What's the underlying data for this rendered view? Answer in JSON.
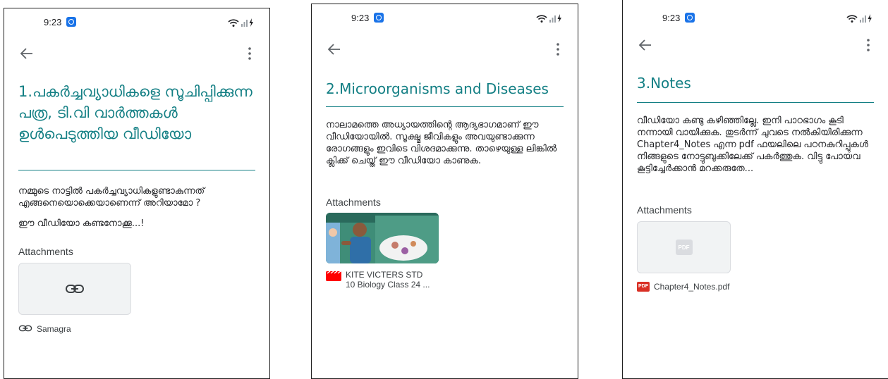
{
  "status_bar": {
    "time": "9:23"
  },
  "screens": [
    {
      "title": "1.പകർച്ചവ്യാധികളെ സൂചിപ്പിക്കുന്ന പത്ര, ടി.വി വാർത്തകൾ ഉൾപെടുത്തിയ വീഡിയോ",
      "paragraphs": [
        "നമ്മുടെ നാട്ടിൽ പകർച്ചവ്യാധികളുണ്ടാകുന്നത് എങ്ങനെയൊക്കെയാണെന്ന് അറിയാമോ ?",
        "ഈ വീഡിയോ കണ്ടനോക്കൂ...!"
      ],
      "attachments_heading": "Attachments",
      "attachment": {
        "kind": "link",
        "icon": "link-icon",
        "label": "Samagra"
      }
    },
    {
      "title": "2.Microorganisms and Diseases",
      "paragraphs": [
        "നാലാമത്തെ അധ്യായത്തിന്റെ ആദ്യഭാഗമാണ് ഈ വീഡിയോയിൽ. സൂക്ഷ്മ ജീവികളും അവയുണ്ടാക്കുന്ന രോഗങ്ങളും ഇവിടെ വിശദമാക്കുന്നു. താഴെയുള്ള ലിങ്കിൽ ക്ലിക്ക് ചെയ്ത് ഈ വീഡിയോ കാണുക."
      ],
      "attachments_heading": "Attachments",
      "attachment": {
        "kind": "video",
        "icon": "youtube-icon",
        "line1": "KITE VICTERS STD",
        "line2": "10 Biology Class 24 ..."
      }
    },
    {
      "title": "3.Notes",
      "paragraphs": [
        "വീഡിയോ കണ്ടു കഴിഞ്ഞില്ലേ. ഇനി പാഠഭാഗം കൂടി നന്നായി വായിക്കുക. തുടർന്ന് ചുവടെ നൽകിയിരിക്കുന്ന Chapter4_Notes എന്ന pdf ഫയലിലെ പഠനകുറിപ്പുകൾ നിങ്ങളുടെ നോട്ടുബുക്കിലേക്ക് പകർത്തുക. വിട്ടു പോയവ കൂട്ടിച്ചേർക്കാൻ മറക്കരുതേ..."
      ],
      "attachments_heading": "Attachments",
      "attachment": {
        "kind": "pdf",
        "icon": "pdf-icon",
        "badge": "PDF",
        "label": "Chapter4_Notes.pdf"
      }
    }
  ],
  "colors": {
    "title_teal": "#137f84",
    "divider": "#137f84",
    "status_app_blue": "#1a73e8",
    "youtube_red": "#ff0000",
    "pdf_red": "#d93025"
  }
}
